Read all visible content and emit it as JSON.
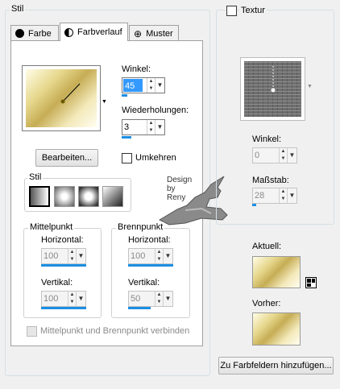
{
  "stil_group": {
    "label": "Stil"
  },
  "tabs": [
    {
      "label": "Farbe",
      "icon": "color-circle-icon"
    },
    {
      "label": "Farbverlauf",
      "icon": "gradient-half-circle-icon"
    },
    {
      "label": "Muster",
      "icon": "pattern-grid-icon"
    }
  ],
  "gradient": {
    "winkel_label": "Winkel:",
    "winkel_value": "45",
    "wiederholungen_label": "Wiederholungen:",
    "wiederholungen_value": "3",
    "bearbeiten_label": "Bearbeiten...",
    "umkehren_label": "Umkehren",
    "stil_label": "Stil",
    "watermark": "Design\nby\nReny",
    "mittelpunkt": {
      "label": "Mittelpunkt",
      "horizontal_label": "Horizontal:",
      "horizontal_value": "100",
      "vertikal_label": "Vertikal:",
      "vertikal_value": "100"
    },
    "brennpunkt": {
      "label": "Brennpunkt",
      "horizontal_label": "Horizontal:",
      "horizontal_value": "100",
      "vertikal_label": "Vertikal:",
      "vertikal_value": "50"
    },
    "verbinden_label": "Mittelpunkt und Brennpunkt verbinden"
  },
  "textur": {
    "label": "Textur",
    "winkel_label": "Winkel:",
    "winkel_value": "0",
    "massstab_label": "Maßstab:",
    "massstab_value": "28"
  },
  "aktuell_label": "Aktuell:",
  "vorher_label": "Vorher:",
  "add_button_label": "Zu Farbfeldern hinzufügen...",
  "colors": {
    "accent": "#1c8fe3",
    "gold_dark": "#c6ad55",
    "gold_light": "#fffde8"
  }
}
